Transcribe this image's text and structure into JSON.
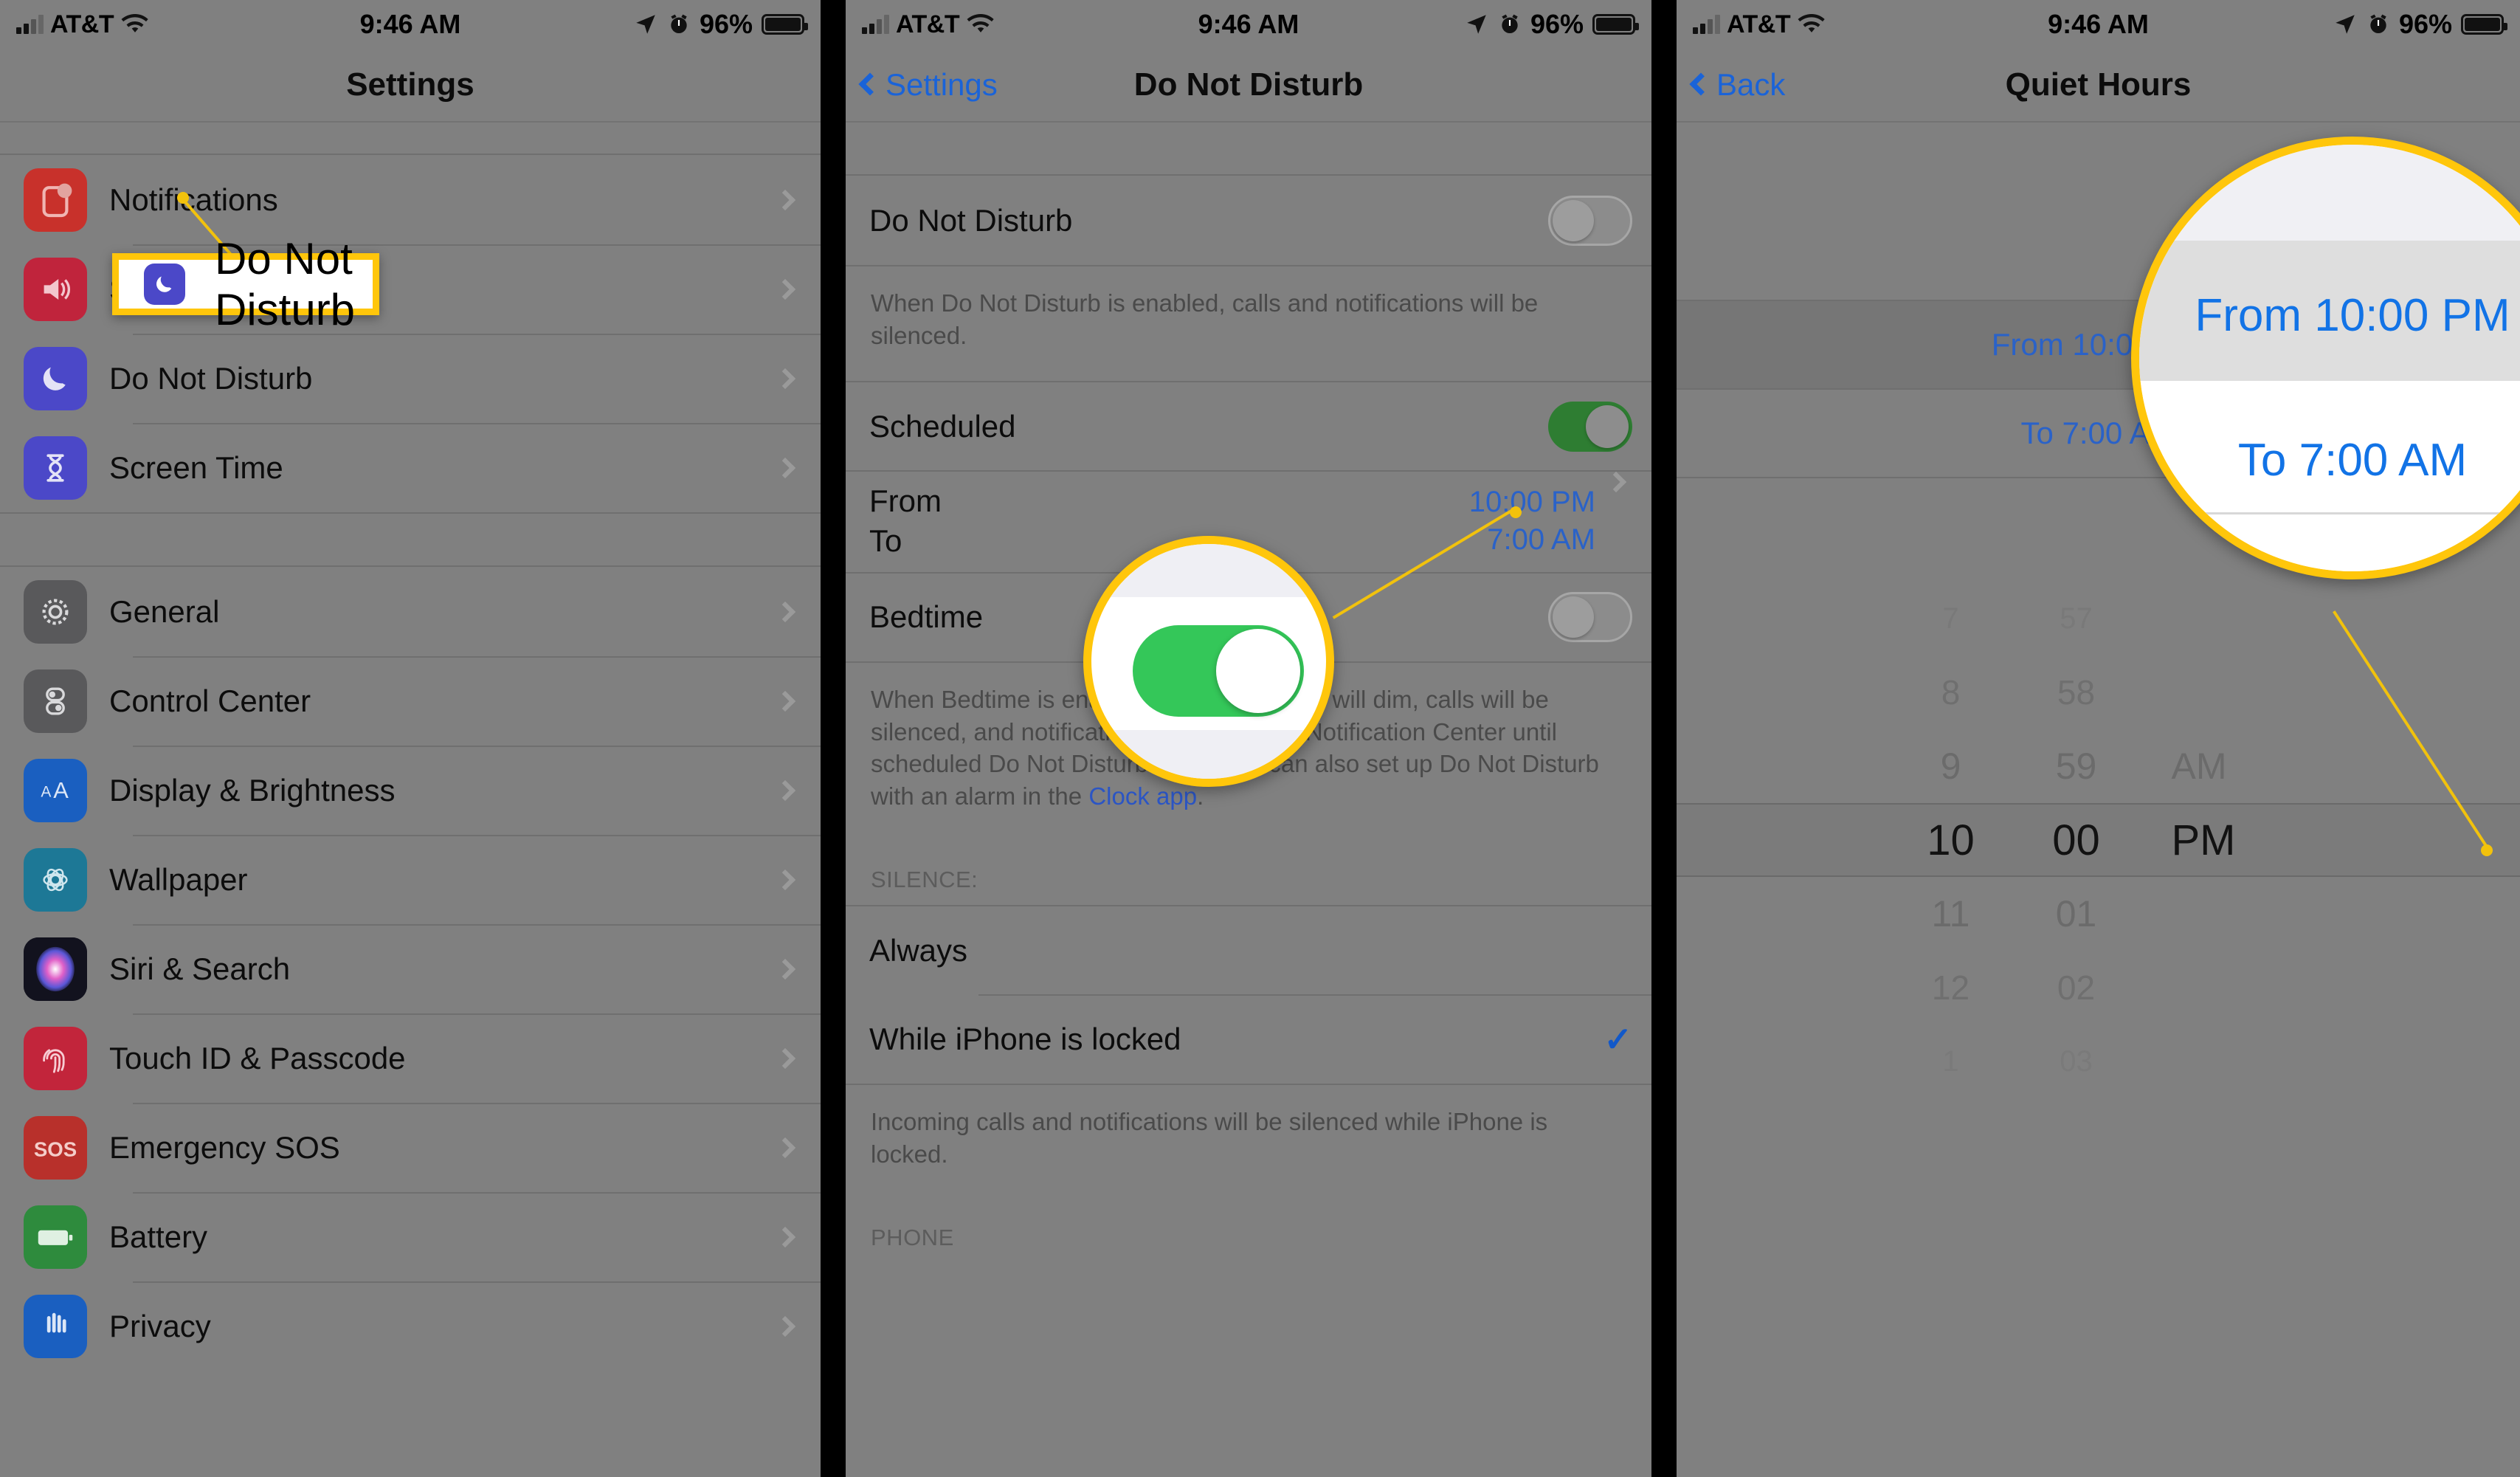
{
  "status_bar": {
    "carrier": "AT&T",
    "time": "9:46 AM",
    "battery_percent": "96%",
    "signal_icon": "cellular-bars-icon",
    "wifi_icon": "wifi-icon",
    "location_icon": "location-arrow-icon",
    "alarm_icon": "alarm-clock-icon",
    "battery_icon": "battery-icon"
  },
  "panel1": {
    "title": "Settings",
    "items": [
      {
        "label": "Notifications",
        "icon": "notifications-icon",
        "color": "#C8312B"
      },
      {
        "label": "Sounds & Haptics",
        "icon": "speaker-icon",
        "color": "#C0243C"
      },
      {
        "label": "Do Not Disturb",
        "icon": "moon-icon",
        "color": "#4B48C8"
      },
      {
        "label": "Screen Time",
        "icon": "hourglass-icon",
        "color": "#4B48C8"
      },
      {
        "label": "General",
        "icon": "gear-icon",
        "color": "#59595B"
      },
      {
        "label": "Control Center",
        "icon": "control-center-icon",
        "color": "#59595B"
      },
      {
        "label": "Display & Brightness",
        "icon": "display-brightness-icon",
        "color": "#1A5FC0"
      },
      {
        "label": "Wallpaper",
        "icon": "wallpaper-flower-icon",
        "color": "#1D7896"
      },
      {
        "label": "Siri & Search",
        "icon": "siri-icon",
        "color": "#12121E"
      },
      {
        "label": "Touch ID & Passcode",
        "icon": "fingerprint-icon",
        "color": "#C2253B"
      },
      {
        "label": "Emergency SOS",
        "icon": "sos-icon",
        "color": "#B8302B"
      },
      {
        "label": "Battery",
        "icon": "battery-app-icon",
        "color": "#2E8B3D"
      },
      {
        "label": "Privacy",
        "icon": "privacy-hand-icon",
        "color": "#1A5FC0"
      }
    ],
    "callout": {
      "label": "Do Not Disturb",
      "icon": "moon-icon",
      "icon_color": "#4B48C8",
      "border_color": "#FFC60B"
    }
  },
  "panel2": {
    "back_label": "Settings",
    "title": "Do Not Disturb",
    "rows": {
      "do_not_disturb_label": "Do Not Disturb",
      "do_not_disturb_state": "off",
      "do_not_disturb_footnote": "When Do Not Disturb is enabled, calls and notifications will be silenced.",
      "scheduled_label": "Scheduled",
      "scheduled_state": "on",
      "from_label": "From",
      "from_value": "10:00 PM",
      "to_label": "To",
      "to_value": "7:00 AM",
      "bedtime_label": "Bedtime",
      "bedtime_state": "off",
      "bedtime_footnote_text": "When Bedtime is enabled, the lock screen will dim, calls will be silenced, and notifications will appear in Notification Center until scheduled Do Not Disturb ends. You can also set up Do Not Disturb with an alarm in the ",
      "bedtime_footnote_link": "Clock app",
      "bedtime_footnote_tail": ".",
      "silence_header": "SILENCE:",
      "silence_always": "Always",
      "silence_locked": "While iPhone is locked",
      "silence_locked_checked": true,
      "silence_footnote": "Incoming calls and notifications will be silenced while iPhone is locked.",
      "phone_header": "PHONE"
    },
    "magnifier": {
      "target": "scheduled-toggle",
      "state": "on",
      "accent_color": "#34C759",
      "border_color": "#FFC60B"
    }
  },
  "panel3": {
    "back_label": "Back",
    "title": "Quiet Hours",
    "from_row": "From 10:00 PM",
    "to_row": "To 7:00 AM",
    "selected_row": "from",
    "magnifier": {
      "line1": "From 10:00 PM",
      "line2": "To 7:00 AM",
      "border_color": "#FFC60B"
    },
    "picker": {
      "hours_above": [
        "7",
        "8",
        "9"
      ],
      "hour_selected": "10",
      "hours_below": [
        "11",
        "12",
        "1"
      ],
      "minutes_above": [
        "57",
        "58",
        "59"
      ],
      "minute_selected": "00",
      "minutes_below": [
        "01",
        "02",
        "03"
      ],
      "meridiem_above": "AM",
      "meridiem_selected": "PM"
    }
  }
}
